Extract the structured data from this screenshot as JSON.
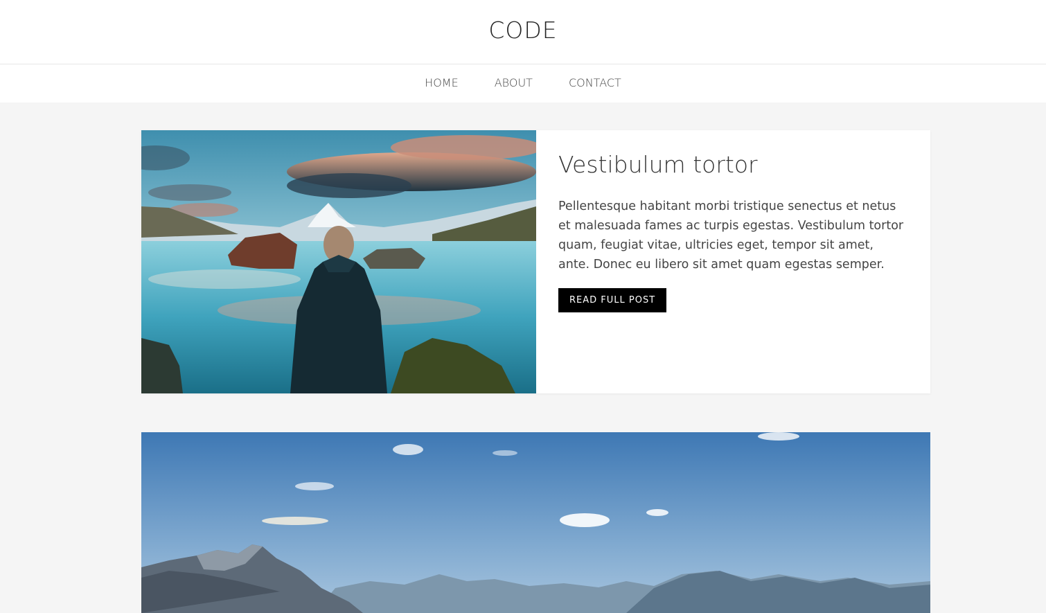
{
  "site": {
    "title": "CODE"
  },
  "nav": {
    "items": [
      {
        "label": "HOME"
      },
      {
        "label": "ABOUT"
      },
      {
        "label": "CONTACT"
      }
    ]
  },
  "posts": [
    {
      "title": "Vestibulum tortor",
      "excerpt": "Pellentesque habitant morbi tristique senectus et netus et malesuada fames ac turpis egestas. Vestibulum tortor quam, feugiat vitae, ultricies eget, tempor sit amet, ante. Donec eu libero sit amet quam egestas semper.",
      "button_label": "READ FULL POST"
    }
  ],
  "colors": {
    "background": "#f5f5f5",
    "card": "#ffffff",
    "button": "#000000",
    "button_text": "#ffffff"
  }
}
